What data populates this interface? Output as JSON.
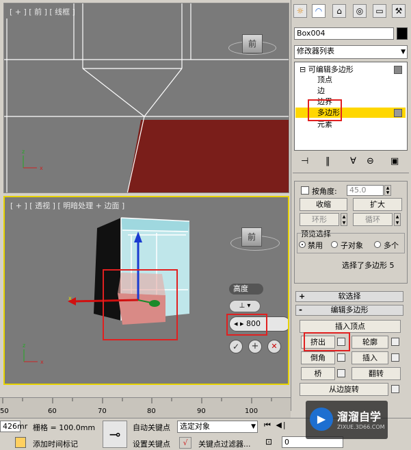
{
  "viewport_front": {
    "label": "[ + ] [ 前 ] [ 线框 ]",
    "cube_label": "前",
    "axis_x": "x",
    "axis_z": "z"
  },
  "viewport_persp": {
    "label": "[ + ] [ 透视 ] [ 明暗处理 + 边面 ]",
    "cube_label": "前",
    "axis_x": "x",
    "axis_z": "z"
  },
  "caddy": {
    "title": "高度",
    "value": "800",
    "ok": "✓",
    "apply": "+",
    "cancel": "✕"
  },
  "cmd_tabs": [
    "☼",
    "◠",
    "⌂",
    "◎",
    "▭",
    "⚒"
  ],
  "object_name": "Box004",
  "modifier_list": "修改器列表",
  "stack": {
    "root": "可编辑多边形",
    "items": [
      "顶点",
      "边",
      "边界",
      "多边形",
      "元素"
    ],
    "selected_index": 3
  },
  "stack_tools": [
    "⊣",
    "‖",
    "∀",
    "⊖",
    "▣"
  ],
  "select": {
    "by_angle_label": "按角度:",
    "by_angle_value": "45.0",
    "shrink": "收缩",
    "grow": "扩大",
    "ring": "环形",
    "loop": "循环",
    "preview_title": "预览选择",
    "opt_disable": "禁用",
    "opt_subobj": "子对象",
    "opt_multi": "多个",
    "status": "选择了多边形 5"
  },
  "soft_selection": {
    "sign": "+",
    "title": "软选择"
  },
  "edit_poly": {
    "sign": "-",
    "title": "编辑多边形",
    "insert_vertex": "插入顶点",
    "extrude": "挤出",
    "outline": "轮廓",
    "bevel": "倒角",
    "inset": "插入",
    "bridge": "桥",
    "flip": "翻转",
    "hinge": "从边旋转"
  },
  "timeline": {
    "ticks": [
      "50",
      "60",
      "70",
      "80",
      "90",
      "100"
    ]
  },
  "status_bar": {
    "coord_partial": "426mr",
    "grid": "栅格 = 100.0mm",
    "auto_key": "自动关键点",
    "set_key": "设置关键点",
    "selected": "选定对象",
    "add_time_tag": "添加时间标记",
    "key_filters": "关键点过滤器...",
    "frame": "0",
    "key_icon": "⊸"
  },
  "watermark": {
    "brand": "溜溜自学",
    "url": "ZIXUE.3D66.COM"
  },
  "colors": {
    "viewport_bg": "#7a7a7a",
    "floor": "#7a1e1a",
    "highlight": "#ffd700",
    "annot_red": "#e02020"
  }
}
